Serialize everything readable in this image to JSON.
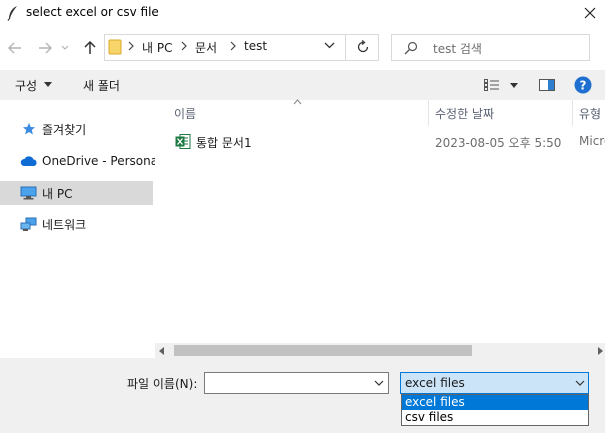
{
  "window": {
    "title": "select excel or csv file"
  },
  "address": {
    "crumbs": [
      "내 PC",
      "문서",
      "test"
    ]
  },
  "search": {
    "placeholder": "test 검색"
  },
  "toolbar": {
    "organize": "구성",
    "new_folder": "새 폴더"
  },
  "nav": {
    "items": [
      {
        "label": "즐겨찾기"
      },
      {
        "label": "OneDrive - Personal"
      },
      {
        "label": "내 PC",
        "selected": true
      },
      {
        "label": "네트워크"
      }
    ]
  },
  "columns": {
    "name": "이름",
    "modified": "수정한 날짜",
    "type": "유형"
  },
  "files": [
    {
      "name": "통합 문서1",
      "modified": "2023-08-05 오후 5:50",
      "type": "Micro"
    }
  ],
  "footer": {
    "filename_label": "파일 이름(N):",
    "filename_value": "",
    "filter_selected": "excel files",
    "filter_options": [
      "excel files",
      "csv files"
    ]
  },
  "colors": {
    "accent": "#0078d7",
    "selection": "#cce4f7",
    "help": "#1e6fd0"
  }
}
